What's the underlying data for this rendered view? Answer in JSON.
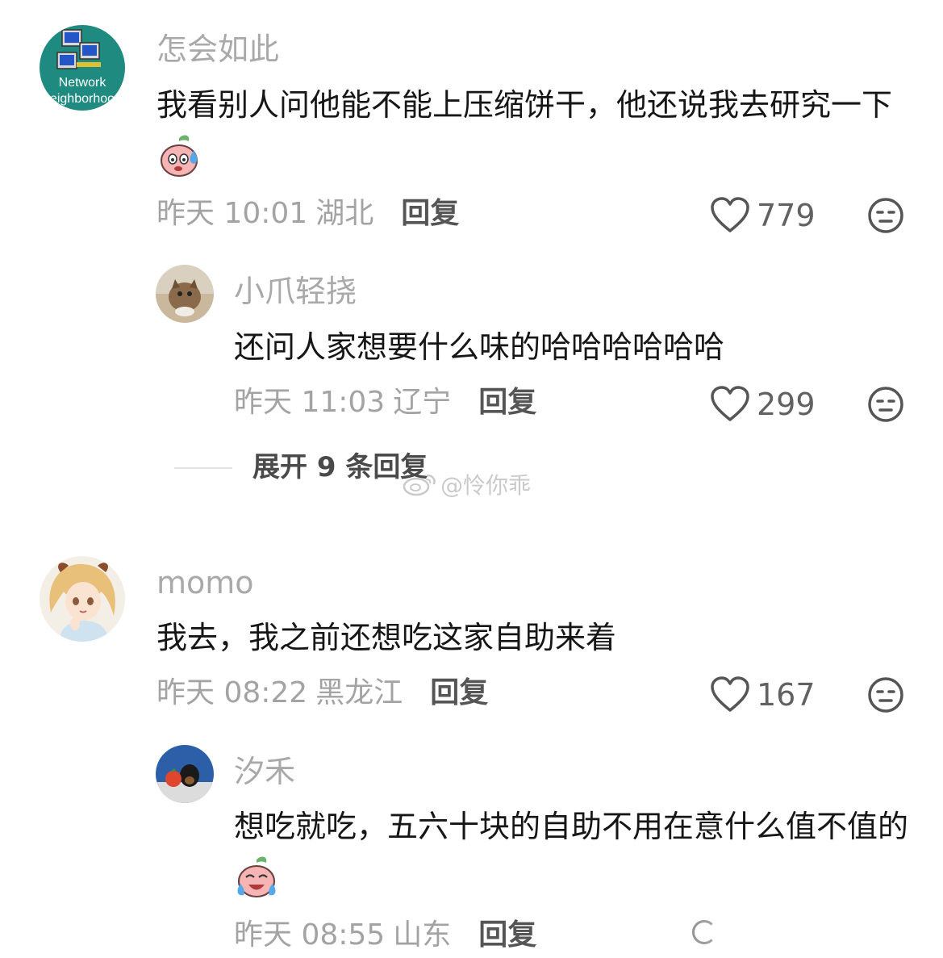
{
  "comments": [
    {
      "username": "怎会如此",
      "avatar_label_1": "Network",
      "avatar_label_2": "eighborhoo",
      "text": "我看别人问他能不能上压缩饼干，他还说我去研究一下",
      "emoji": "sweat-peach-emoji",
      "time": "昨天 10:01",
      "location": "湖北",
      "reply_label": "回复",
      "likes": "779",
      "dislike_icon": "neutral-face-icon",
      "replies": [
        {
          "username": "小爪轻挠",
          "text": "还问人家想要什么味的哈哈哈哈哈哈",
          "time": "昨天 11:03",
          "location": "辽宁",
          "reply_label": "回复",
          "likes": "299"
        }
      ],
      "expand_label": "展开 9 条回复"
    },
    {
      "username": "momo",
      "text": "我去，我之前还想吃这家自助来着",
      "time": "昨天 08:22",
      "location": "黑龙江",
      "reply_label": "回复",
      "likes": "167",
      "replies": [
        {
          "username": "汐禾",
          "text": "想吃就吃，五六十块的自助不用在意什么值不值的",
          "emoji": "crying-laugh-peach-emoji",
          "time": "昨天 08:55",
          "location": "山东",
          "reply_label": "回复"
        }
      ]
    }
  ],
  "watermark": "@怜你乖",
  "colors": {
    "username": "#a9a9a9",
    "text": "#161616",
    "meta": "#a3a3a3",
    "reply": "#555555",
    "avatar_network_bg": "#1e8a80"
  }
}
